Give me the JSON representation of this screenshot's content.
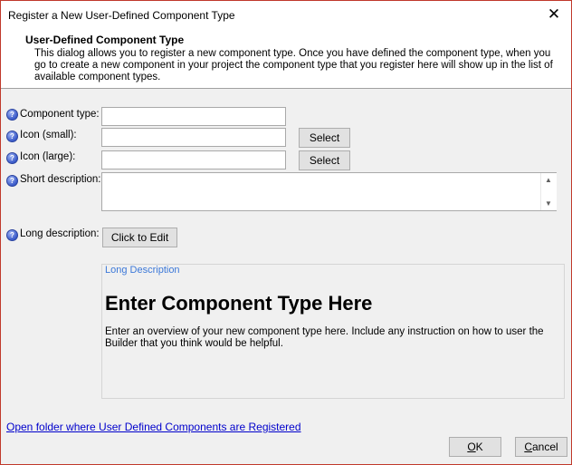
{
  "window": {
    "title": "Register a New User-Defined Component Type",
    "close_glyph": "✕"
  },
  "header": {
    "title": "User-Defined Component Type",
    "description": "This dialog allows you to register a new component type. Once you have defined the component type, when you go to create a new component in your project the component type that you register here will show up in the list of available component types."
  },
  "form": {
    "help_glyph": "?",
    "component_type": {
      "label": "Component type:",
      "value": ""
    },
    "icon_small": {
      "label": "Icon (small):",
      "value": "",
      "button": "Select"
    },
    "icon_large": {
      "label": "Icon (large):",
      "value": "",
      "button": "Select"
    },
    "short_description": {
      "label": "Short description:",
      "value": ""
    },
    "long_description": {
      "label": "Long description:",
      "button": "Click to Edit"
    }
  },
  "long_preview": {
    "legend": "Long Description",
    "heading": "Enter Component Type Here",
    "body": "Enter an overview of your new component type here. Include any instruction on how to user the Builder that you think would be helpful."
  },
  "footer": {
    "link": "Open folder where User Defined Components are Registered",
    "ok": {
      "accel": "O",
      "rest": "K"
    },
    "cancel": {
      "accel": "C",
      "rest": "ancel"
    }
  }
}
